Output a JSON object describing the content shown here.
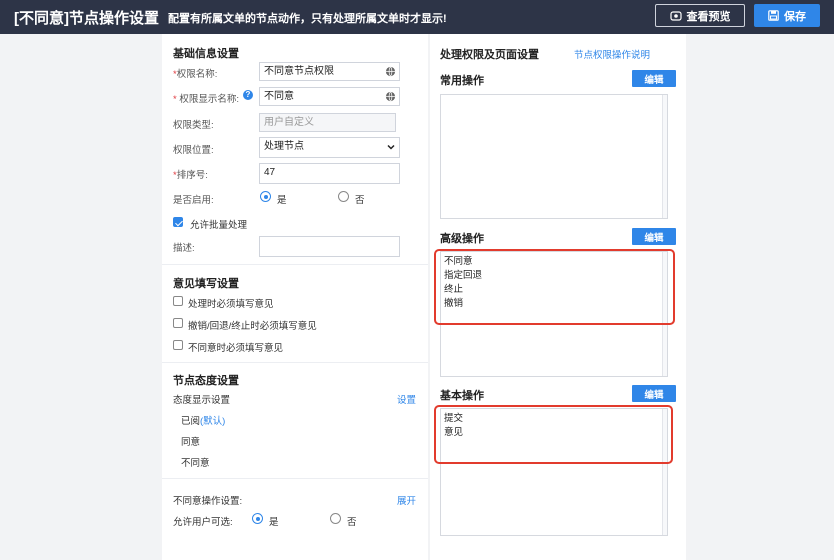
{
  "header": {
    "title": "[不同意]节点操作设置",
    "subtitle": "配置有所属文单的节点动作，只有处理所属文单时才显示!",
    "preview_label": "查看预览",
    "save_label": "保存"
  },
  "basic": {
    "section_title": "基础信息设置",
    "perm_name_label": "权限名称:",
    "perm_name_value": "不同意节点权限",
    "perm_display_label": "权限显示名称:",
    "perm_display_value": "不同意",
    "perm_type_label": "权限类型:",
    "perm_type_value": "用户自定义",
    "perm_position_label": "权限位置:",
    "perm_position_value": "处理节点",
    "sort_label": "排序号:",
    "sort_value": "47",
    "enabled_label": "是否启用:",
    "yes_label": "是",
    "no_label": "否",
    "batch_label": "允许批量处理",
    "desc_label": "描述:",
    "desc_value": ""
  },
  "opinion": {
    "section_title": "意见填写设置",
    "opt1": "处理时必须填写意见",
    "opt2": "撤销/回退/终止时必须填写意见",
    "opt3": "不同意时必须填写意见"
  },
  "attitude": {
    "section_title": "节点态度设置",
    "display_label": "态度显示设置",
    "set_link": "设置",
    "item1": "已阅",
    "item1_suffix": "(默认)",
    "item2": "同意",
    "item3": "不同意"
  },
  "disagree": {
    "ops_label": "不同意操作设置:",
    "expand_link": "展开",
    "allow_label": "允许用户可选:",
    "yes_label": "是",
    "no_label": "否"
  },
  "right": {
    "section_title": "处理权限及页面设置",
    "help_link": "节点权限操作说明",
    "common_title": "常用操作",
    "advanced_title": "高级操作",
    "basic_title": "基本操作",
    "edit_label": "编辑",
    "advanced_ops": [
      "不同意",
      "指定回退",
      "终止",
      "撤销"
    ],
    "basic_ops": [
      "提交",
      "意见"
    ]
  },
  "colors": {
    "topbar": "#2d3447",
    "accent": "#2f86e8",
    "highlight": "#e23b2d"
  }
}
